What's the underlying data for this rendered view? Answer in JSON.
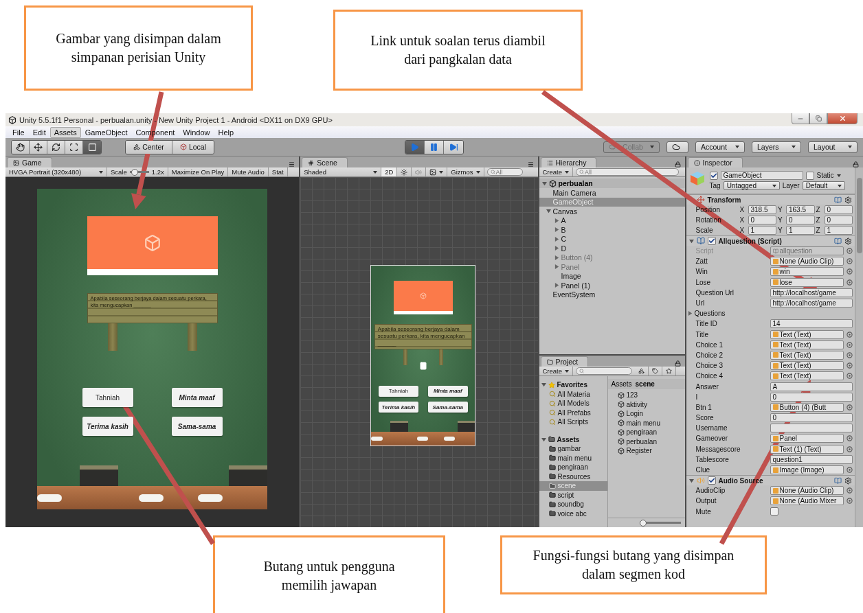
{
  "annotations": {
    "top": [
      {
        "text": "Gambar yang disimpan dalam simpanan perisian Unity"
      },
      {
        "text": "Link untuk soalan terus diambil dari pangkalan data"
      }
    ],
    "bottom": [
      {
        "text": "Butang untuk pengguna memilih jawapan"
      },
      {
        "text": "Fungsi-fungsi butang yang disimpan dalam segmen kod"
      }
    ]
  },
  "window": {
    "title": "Unity 5.5.1f1 Personal - perbualan.unity - New Unity Project 1 - Android <DX11 on DX9 GPU>"
  },
  "menu": [
    {
      "label": "File",
      "selected": false
    },
    {
      "label": "Edit",
      "selected": false
    },
    {
      "label": "Assets",
      "selected": true
    },
    {
      "label": "GameObject",
      "selected": false
    },
    {
      "label": "Component",
      "selected": false
    },
    {
      "label": "Window",
      "selected": false
    },
    {
      "label": "Help",
      "selected": false
    }
  ],
  "toolbar": {
    "tools": [
      {
        "kind": "hand",
        "selected": false
      },
      {
        "kind": "move",
        "selected": false
      },
      {
        "kind": "rotate",
        "selected": false
      },
      {
        "kind": "scale",
        "selected": false
      },
      {
        "kind": "rect",
        "selected": true
      }
    ],
    "pivot": [
      "Center",
      "Local"
    ],
    "playback": [
      {
        "kind": "play",
        "selected": true
      },
      {
        "kind": "pause",
        "selected": false
      },
      {
        "kind": "step",
        "selected": false
      }
    ],
    "collab": "Collab",
    "account": "Account",
    "layers": "Layers",
    "layout": "Layout"
  },
  "game": {
    "tab": "Game",
    "resolution": "HVGA Portrait (320x480)",
    "scale_label": "Scale",
    "scale": {
      "level": 0.15
    },
    "scale_value": "1.2x",
    "buttons": [
      "Maximize On Play",
      "Mute Audio",
      "Stat"
    ],
    "question": "Apabila seseorang berjaya dalam sesuatu perkara, kita mengucapkan ______",
    "answers": [
      {
        "label": "Tahniah",
        "italic": false
      },
      {
        "label": "Minta maaf",
        "italic": true
      },
      {
        "label": "Terima kasih",
        "italic": true
      },
      {
        "label": "Sama-sama",
        "italic": true
      }
    ]
  },
  "scene": {
    "tab": "Scene",
    "shading": "Shaded",
    "mode_2d": {
      "label": "2D",
      "on": true
    },
    "gizmos": "Gizmos",
    "search": "All",
    "question": "Apabila seseorang berjaya dalam sesuatu perkara, kita mengucapkan ______",
    "answers": [
      {
        "label": "Tahniah",
        "italic": false
      },
      {
        "label": "Minta maaf",
        "italic": true
      },
      {
        "label": "Terima kasih",
        "italic": true
      },
      {
        "label": "Sama-sama",
        "italic": true
      }
    ]
  },
  "hierarchy": {
    "tab": "Hierarchy",
    "create": "Create",
    "search": "All",
    "scene": "perbualan",
    "items": [
      {
        "label": "Main Camera",
        "selected": false,
        "active": true
      },
      {
        "label": "GameObject",
        "selected": true,
        "active": true
      },
      {
        "label": "Canvas",
        "selected": false,
        "active": true,
        "expanded": true,
        "children": [
          {
            "label": "A",
            "selected": false,
            "active": true,
            "expanded": false
          },
          {
            "label": "B",
            "selected": false,
            "active": true,
            "expanded": false
          },
          {
            "label": "C",
            "selected": false,
            "active": true,
            "expanded": false
          },
          {
            "label": "D",
            "selected": false,
            "active": true,
            "expanded": false
          },
          {
            "label": "Button (4)",
            "selected": false,
            "active": false,
            "expanded": false
          },
          {
            "label": "Panel",
            "selected": false,
            "active": false,
            "expanded": false
          },
          {
            "label": "Image",
            "selected": false,
            "active": true
          },
          {
            "label": "Panel (1)",
            "selected": false,
            "active": true,
            "expanded": false
          }
        ]
      },
      {
        "label": "EventSystem",
        "selected": false,
        "active": true
      }
    ]
  },
  "project": {
    "tab": "Project",
    "create": "Create",
    "favorites": {
      "label": "Favorites",
      "items": [
        "All Materia",
        "All Models",
        "All Prefabs",
        "All Scripts"
      ]
    },
    "assets": {
      "label": "Assets",
      "items": [
        {
          "label": "gambar",
          "selected": false
        },
        {
          "label": "main menu",
          "selected": false
        },
        {
          "label": "pengiraan",
          "selected": false
        },
        {
          "label": "Resources",
          "selected": false
        },
        {
          "label": "scene",
          "selected": true
        },
        {
          "label": "script",
          "selected": false
        },
        {
          "label": "soundbg",
          "selected": false
        },
        {
          "label": "voice abc",
          "selected": false
        }
      ]
    },
    "breadcrumb": [
      "Assets",
      "scene"
    ],
    "zoom": {
      "level": 0
    },
    "files": [
      "123",
      "aktivity",
      "Login",
      "main menu",
      "pengiraan",
      "perbualan",
      "Register"
    ]
  },
  "inspector": {
    "tab": "Inspector",
    "name": "GameObject",
    "enabled": true,
    "static_label": "Static",
    "static": false,
    "tag_label": "Tag",
    "tag": "Untagged",
    "layer_label": "Layer",
    "layer": "Default",
    "components": [
      {
        "kind": "transform",
        "title": "Transform",
        "rows": [
          {
            "label": "Position",
            "values": [
              {
                "axis": "X",
                "value": "318.5"
              },
              {
                "axis": "Y",
                "value": "163.5"
              },
              {
                "axis": "Z",
                "value": "0"
              }
            ]
          },
          {
            "label": "Rotation",
            "values": [
              {
                "axis": "X",
                "value": "0"
              },
              {
                "axis": "Y",
                "value": "0"
              },
              {
                "axis": "Z",
                "value": "0"
              }
            ]
          },
          {
            "label": "Scale",
            "values": [
              {
                "axis": "X",
                "value": "1"
              },
              {
                "axis": "Y",
                "value": "1"
              },
              {
                "axis": "Z",
                "value": "1"
              }
            ]
          }
        ]
      },
      {
        "kind": "script",
        "title": "Allquestion (Script)",
        "enabled": true,
        "fields": [
          {
            "kind": "script",
            "label": "Script",
            "value": "allquestion"
          },
          {
            "kind": "object",
            "label": "Zatt",
            "value": "None (Audio Clip)"
          },
          {
            "kind": "object",
            "label": "Win",
            "value": "win"
          },
          {
            "kind": "object",
            "label": "Lose",
            "value": "lose"
          },
          {
            "kind": "text",
            "label": "Question Url",
            "value": "http://localhost/game"
          },
          {
            "kind": "text",
            "label": "Url",
            "value": "http://localhost/game"
          },
          {
            "kind": "foldout",
            "label": "Questions"
          },
          {
            "kind": "text",
            "label": "Title ID",
            "value": "14"
          },
          {
            "kind": "object",
            "label": "Title",
            "value": "Text (Text)"
          },
          {
            "kind": "object",
            "label": "Choice 1",
            "value": "Text (Text)"
          },
          {
            "kind": "object",
            "label": "Choice 2",
            "value": "Text (Text)"
          },
          {
            "kind": "object",
            "label": "Choice 3",
            "value": "Text (Text)"
          },
          {
            "kind": "object",
            "label": "Choice 4",
            "value": "Text (Text)"
          },
          {
            "kind": "text",
            "label": "Answer",
            "value": "A"
          },
          {
            "kind": "text",
            "label": "I",
            "value": "0"
          },
          {
            "kind": "object",
            "label": "Btn 1",
            "value": "Button (4) (Butt"
          },
          {
            "kind": "text",
            "label": "Score",
            "value": "0"
          },
          {
            "kind": "text",
            "label": "Username"
          },
          {
            "kind": "object",
            "label": "Gameover",
            "value": "Panel"
          },
          {
            "kind": "object",
            "label": "Messagescore",
            "value": "Text (1) (Text)"
          },
          {
            "kind": "text",
            "label": "Tablescore",
            "value": "question1"
          },
          {
            "kind": "object",
            "label": "Clue",
            "value": "Image (Image)"
          }
        ]
      },
      {
        "kind": "audio",
        "title": "Audio Source",
        "enabled": true,
        "fields": [
          {
            "kind": "object",
            "label": "AudioClip",
            "value": "None (Audio Clip)"
          },
          {
            "kind": "object",
            "label": "Output",
            "value": "None (Audio Mixer"
          },
          {
            "kind": "checkbox",
            "label": "Mute",
            "checked": false
          }
        ]
      }
    ]
  }
}
